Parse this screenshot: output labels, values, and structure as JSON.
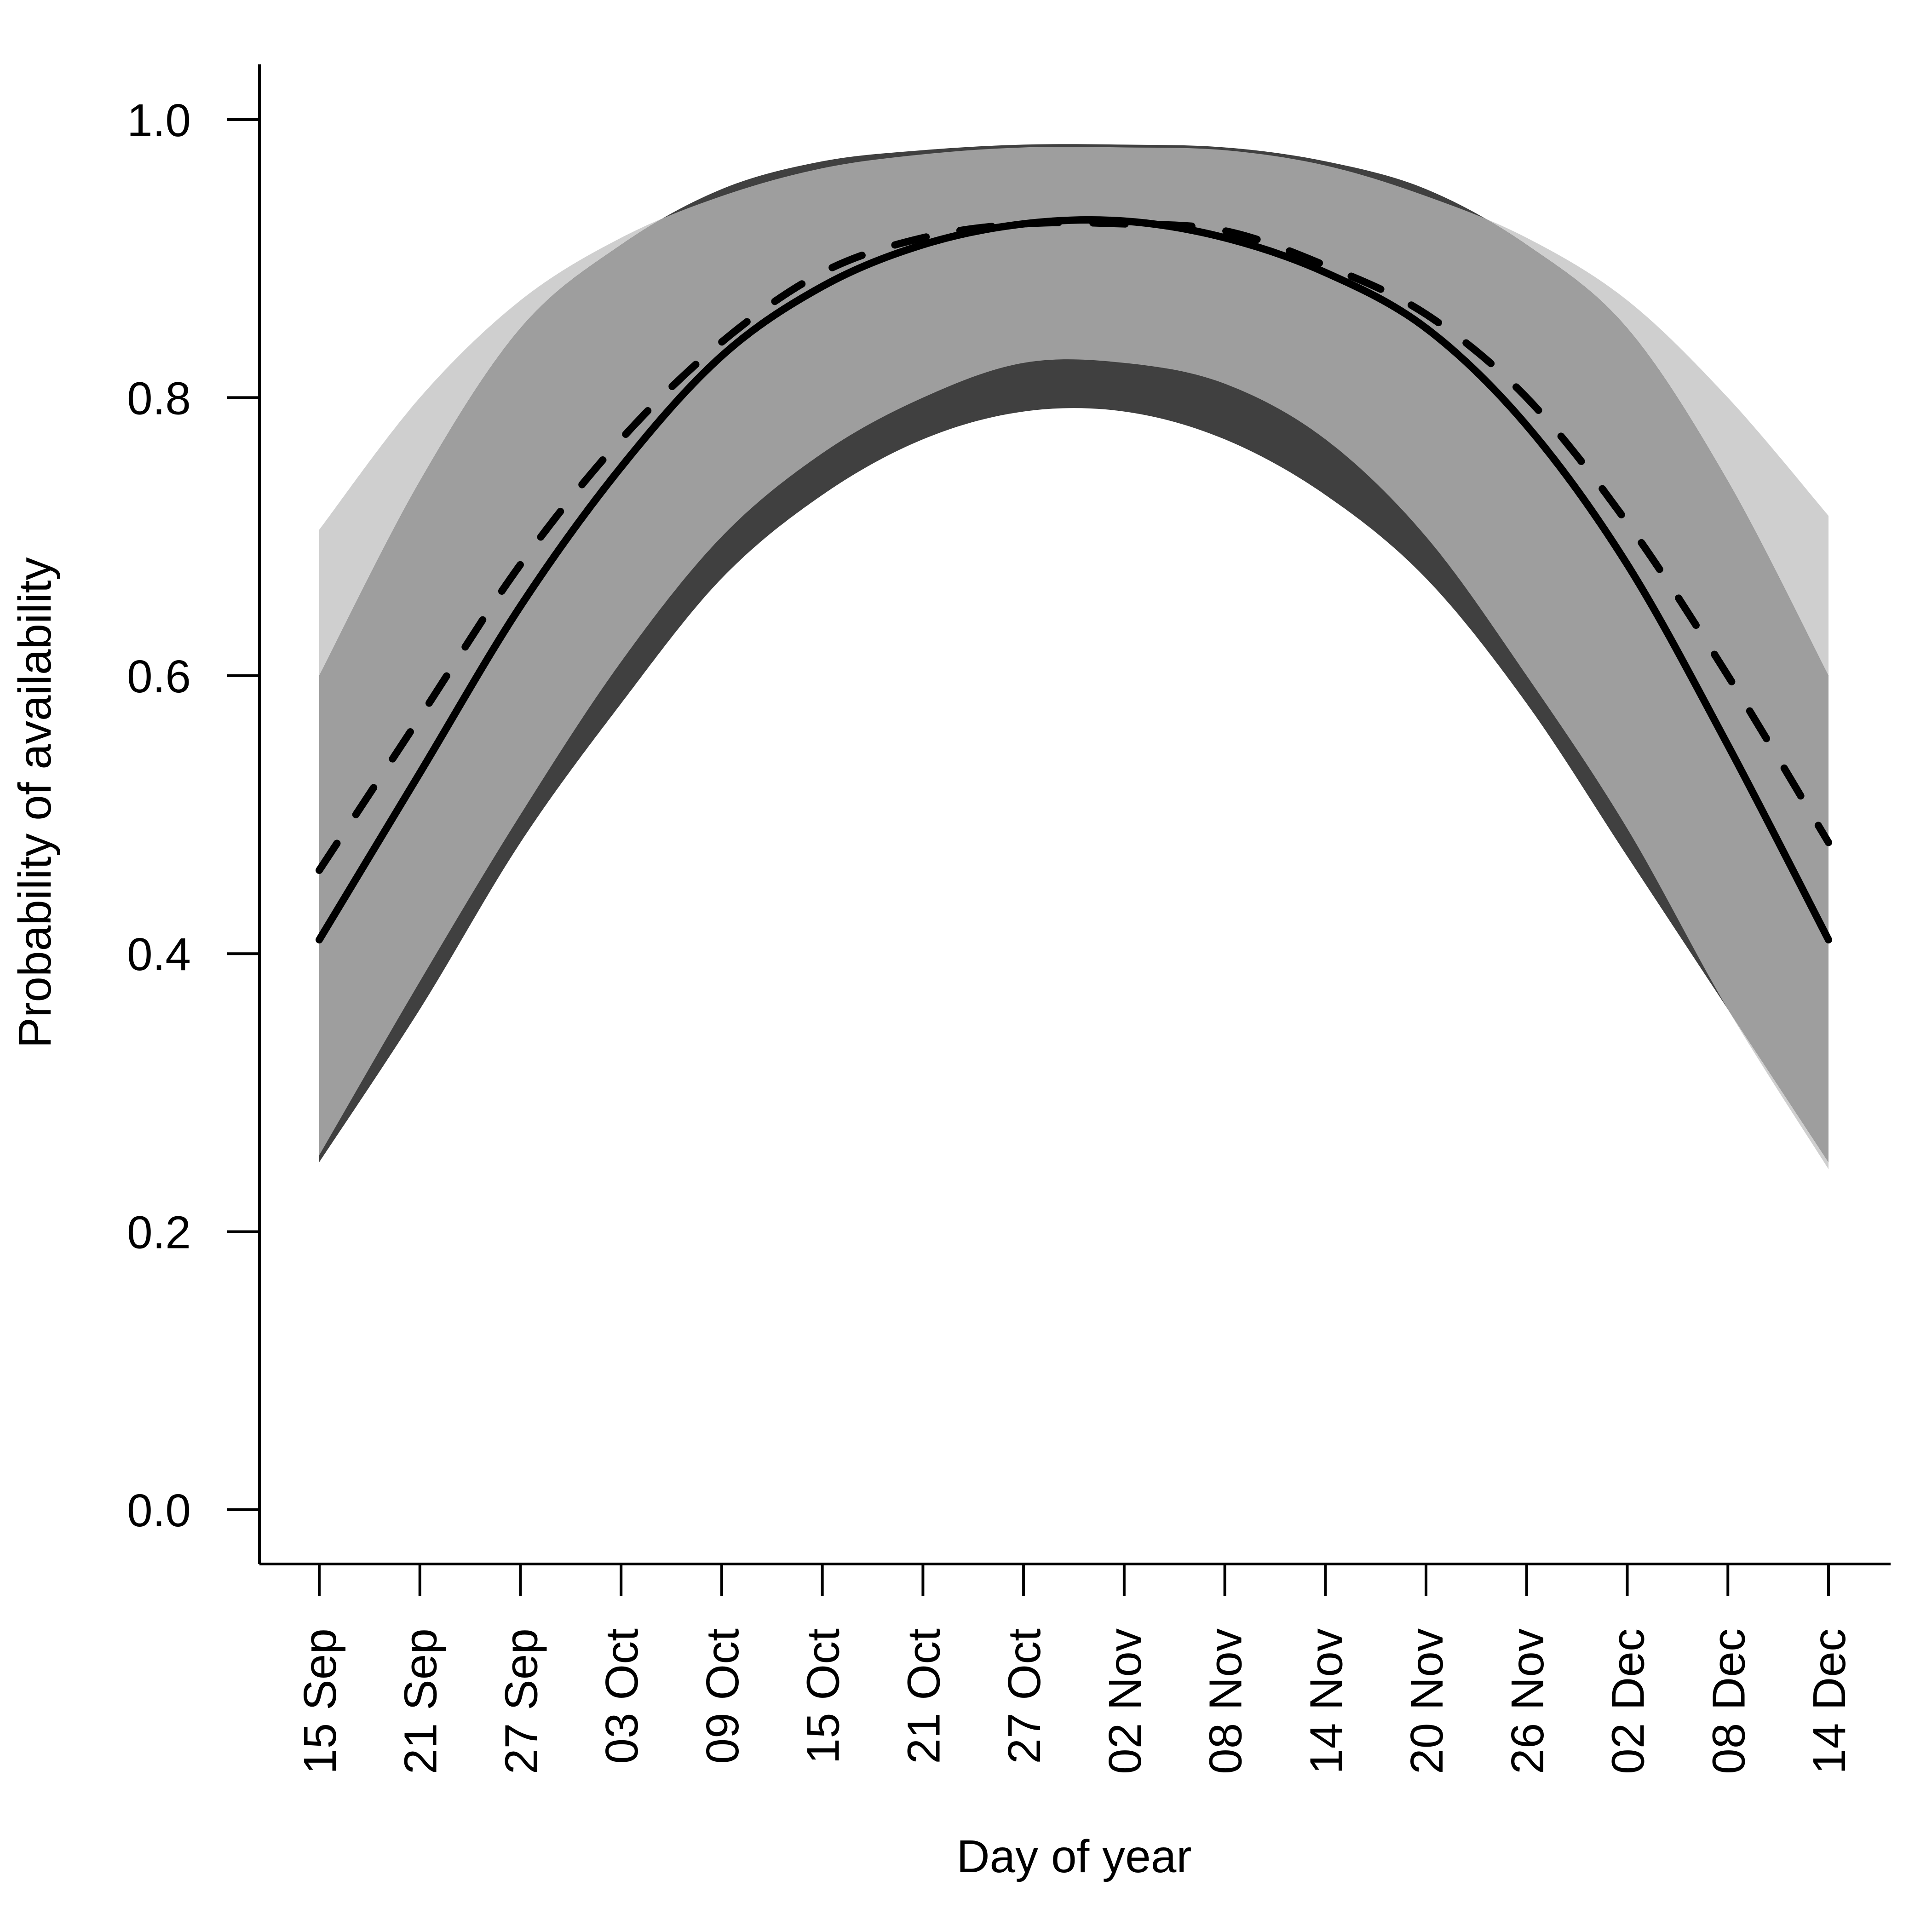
{
  "chart_data": {
    "type": "line",
    "title": "",
    "xlabel": "Day of year",
    "ylabel": "Probability of availability",
    "xlim": [
      0,
      90
    ],
    "ylim": [
      -0.04,
      1.04
    ],
    "grid": false,
    "legend": null,
    "x_ticks": [
      0,
      6,
      12,
      18,
      24,
      30,
      36,
      42,
      48,
      54,
      60,
      66,
      72,
      78,
      84,
      90
    ],
    "x_tick_labels": [
      "15 Sep",
      "21 Sep",
      "27 Sep",
      "03 Oct",
      "09 Oct",
      "15 Oct",
      "21 Oct",
      "27 Oct",
      "02 Nov",
      "08 Nov",
      "14 Nov",
      "20 Nov",
      "26 Nov",
      "02 Dec",
      "08 Dec",
      "14 Dec"
    ],
    "y_ticks": [
      0.0,
      0.2,
      0.4,
      0.6,
      0.8,
      1.0
    ],
    "y_tick_labels": [
      "0.0",
      "0.2",
      "0.4",
      "0.6",
      "0.8",
      "1.0"
    ],
    "x": [
      0,
      6,
      12,
      18,
      24,
      30,
      36,
      42,
      48,
      54,
      60,
      66,
      72,
      78,
      84,
      90
    ],
    "bands": [
      {
        "name": "interval-light",
        "color": "#cfcfcf",
        "lower": [
          0.255,
          0.38,
          0.5,
          0.61,
          0.7,
          0.76,
          0.8,
          0.825,
          0.825,
          0.81,
          0.77,
          0.7,
          0.6,
          0.49,
          0.36,
          0.245
        ],
        "upper": [
          0.705,
          0.8,
          0.87,
          0.915,
          0.945,
          0.965,
          0.975,
          0.98,
          0.98,
          0.978,
          0.967,
          0.945,
          0.915,
          0.87,
          0.8,
          0.715
        ]
      },
      {
        "name": "interval-dark",
        "color": "#404040",
        "lower": [
          0.25,
          0.36,
          0.48,
          0.58,
          0.67,
          0.73,
          0.77,
          0.79,
          0.79,
          0.77,
          0.73,
          0.67,
          0.58,
          0.47,
          0.36,
          0.25
        ],
        "upper": [
          0.6,
          0.74,
          0.85,
          0.91,
          0.95,
          0.97,
          0.978,
          0.982,
          0.982,
          0.98,
          0.97,
          0.95,
          0.91,
          0.85,
          0.74,
          0.6
        ]
      }
    ],
    "overlap_color": "#9e9e9e",
    "series": [
      {
        "name": "solid",
        "style": "solid",
        "color": "#000000",
        "values": [
          0.41,
          0.53,
          0.65,
          0.75,
          0.83,
          0.88,
          0.91,
          0.925,
          0.927,
          0.915,
          0.89,
          0.85,
          0.78,
          0.68,
          0.55,
          0.41
        ]
      },
      {
        "name": "dashed",
        "style": "dashed",
        "color": "#000000",
        "values": [
          0.46,
          0.57,
          0.68,
          0.77,
          0.84,
          0.89,
          0.915,
          0.925,
          0.925,
          0.92,
          0.895,
          0.86,
          0.8,
          0.71,
          0.6,
          0.48
        ]
      }
    ]
  }
}
